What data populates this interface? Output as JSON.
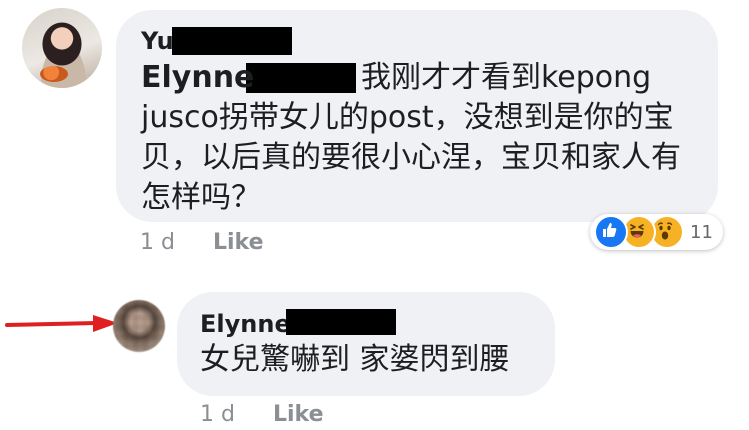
{
  "colors": {
    "bubble": "#f0f1f4",
    "meta_text": "#8b8e93",
    "arrow": "#e02020",
    "like_reaction": "#1877f2",
    "emoji_reaction": "#f7b125"
  },
  "comments": [
    {
      "author": "Yu",
      "mention": "Elynne",
      "text": "我刚才才看到kepong jusco拐带女儿的post，没想到是你的宝贝，以后真的要很小心涅，宝贝和家人有怎样吗？",
      "time": "1 d",
      "like_label": "Like",
      "reactions": {
        "icons": [
          "thumbs-up-icon",
          "laughing-face-icon",
          "surprised-face-icon"
        ],
        "count": "11"
      }
    },
    {
      "author": "Elynne",
      "text": "女兒驚嚇到 家婆閃到腰",
      "time": "1 d",
      "like_label": "Like"
    }
  ]
}
